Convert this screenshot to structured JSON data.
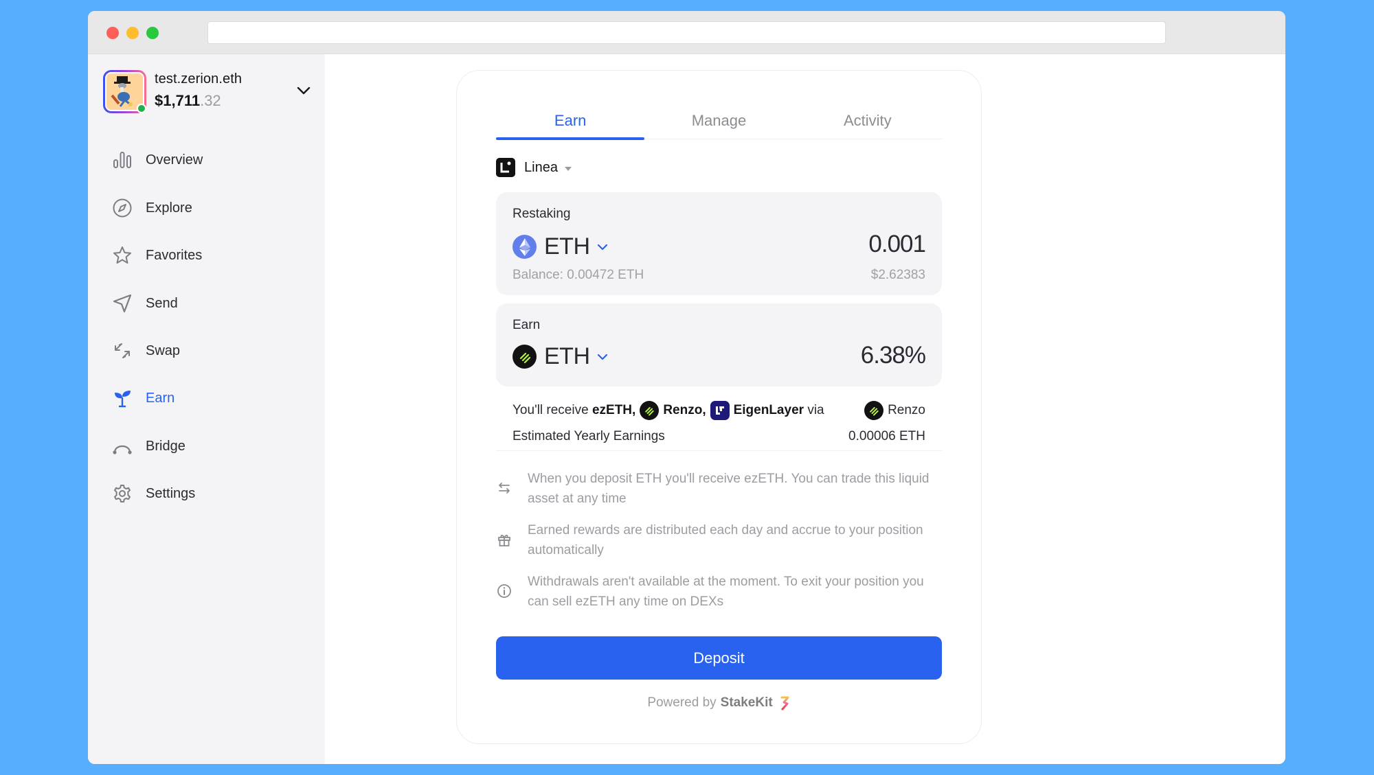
{
  "window": {
    "url": ""
  },
  "profile": {
    "name": "test.zerion.eth",
    "balance_main": "$1,711",
    "balance_cents": ".32",
    "status": "online"
  },
  "sidebar": {
    "items": [
      {
        "label": "Overview",
        "icon": "bar-chart-icon",
        "active": false
      },
      {
        "label": "Explore",
        "icon": "compass-icon",
        "active": false
      },
      {
        "label": "Favorites",
        "icon": "star-icon",
        "active": false
      },
      {
        "label": "Send",
        "icon": "send-icon",
        "active": false
      },
      {
        "label": "Swap",
        "icon": "swap-icon",
        "active": false
      },
      {
        "label": "Earn",
        "icon": "sprout-icon",
        "active": true
      },
      {
        "label": "Bridge",
        "icon": "bridge-icon",
        "active": false
      },
      {
        "label": "Settings",
        "icon": "gear-icon",
        "active": false
      }
    ]
  },
  "tabs": [
    {
      "label": "Earn",
      "active": true
    },
    {
      "label": "Manage",
      "active": false
    },
    {
      "label": "Activity",
      "active": false
    }
  ],
  "network": {
    "label": "Linea",
    "icon": "linea-logo-icon"
  },
  "stake_box": {
    "label": "Restaking",
    "token": "ETH",
    "amount": "0.001",
    "balance": "Balance: 0.00472 ETH",
    "usd_value": "$2.62383"
  },
  "earn_box": {
    "label": "Earn",
    "token": "ETH",
    "apy": "6.38%"
  },
  "summary": {
    "receive_prefix": "You'll receive",
    "receive_token": "ezETH,",
    "provider_1": "Renzo,",
    "provider_2": "EigenLayer",
    "via_label": "via",
    "via_provider": "Renzo",
    "yearly_label": "Estimated Yearly Earnings",
    "yearly_value": "0.00006 ETH"
  },
  "info": [
    {
      "icon": "swap-arrows-icon",
      "text": "When you deposit ETH you'll receive ezETH. You can trade this liquid asset at any time"
    },
    {
      "icon": "gift-icon",
      "text": "Earned rewards are distributed each day and accrue to your position automatically"
    },
    {
      "icon": "info-icon",
      "text": "Withdrawals aren't available at the moment. To exit your position you can sell ezETH any time on DEXs"
    }
  ],
  "deposit_label": "Deposit",
  "powered": {
    "prefix": "Powered by",
    "brand": "StakeKit"
  },
  "colors": {
    "accent": "#2962ef",
    "background": "#57aefe",
    "sidebar": "#f4f4f6",
    "online": "#1fb24c"
  }
}
